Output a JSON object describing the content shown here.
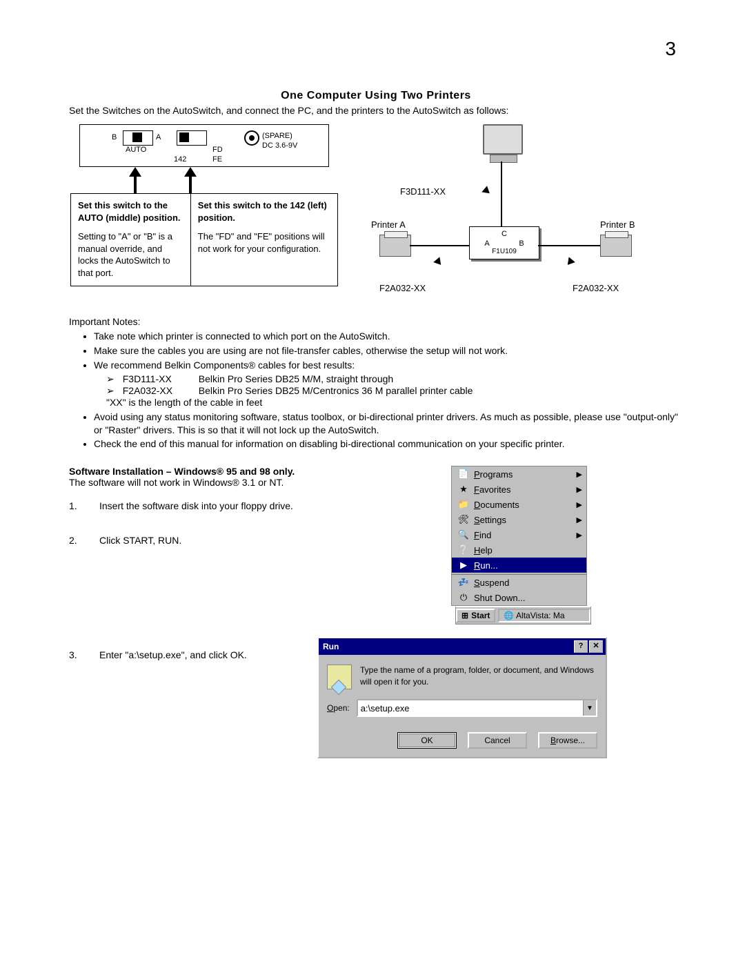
{
  "page_number": "3",
  "title": "One Computer Using Two Printers",
  "intro": "Set the Switches on the AutoSwitch, and connect the PC, and the printers to the AutoSwitch as follows:",
  "switch_panel": {
    "labels": {
      "b": "B",
      "a": "A",
      "auto": "AUTO",
      "n142": "142",
      "fd": "FD",
      "fe": "FE",
      "spare": "(SPARE)",
      "dc": "DC 3.6-9V"
    }
  },
  "note_left": {
    "p1a": "Set this switch to the ",
    "p1b": "AUTO (middle) position.",
    "p2": "Setting to \"A\" or \"B\" is a manual override, and locks the AutoSwitch to that port."
  },
  "note_right": {
    "p1a": "Set this switch to the ",
    "p1b": "142 (left) position.",
    "p2": "The \"FD\" and \"FE\" positions will not work for your configuration."
  },
  "conn": {
    "top_cable": "F3D111-XX",
    "printer_a": "Printer A",
    "printer_b": "Printer B",
    "hub_c": "C",
    "hub_a": "A",
    "hub_b": "B",
    "hub_model": "F1U109",
    "bottom_left": "F2A032-XX",
    "bottom_right": "F2A032-XX"
  },
  "notes_heading": "Important Notes:",
  "bullets": [
    "Take note which printer is connected to which port on the AutoSwitch.",
    "Make sure the cables you are using are not file-transfer cables, otherwise the setup will not work.",
    "We recommend Belkin Components® cables for best results:"
  ],
  "cable_recs": [
    {
      "part": "F3D111-XX",
      "desc": "Belkin Pro Series DB25 M/M, straight through"
    },
    {
      "part": "F2A032-XX",
      "desc": "Belkin Pro Series DB25 M/Centronics 36 M parallel printer cable"
    }
  ],
  "cable_footer": "\"XX\" is the length of the cable in feet",
  "bullets2": [
    "Avoid using any status monitoring software, status toolbox, or bi-directional printer drivers.  As much as possible, please use \"output-only\" or \"Raster\" drivers.  This is so that it will not lock up the AutoSwitch.",
    "Check the end of this manual for information on disabling bi-directional communication on your specific printer."
  ],
  "software_heading": "Software Installation – Windows® 95 and 98 only.",
  "software_sub": "The software will not work in Windows® 3.1 or NT.",
  "steps": {
    "s1": {
      "n": "1.",
      "t": "Insert the software disk into your floppy drive."
    },
    "s2": {
      "n": "2.",
      "t": "Click START, RUN."
    },
    "s3": {
      "n": "3.",
      "t": "Enter \"a:\\setup.exe\", and click OK."
    }
  },
  "start_menu": {
    "items": [
      {
        "icon": "📄",
        "label": "Programs",
        "arrow": true
      },
      {
        "icon": "★",
        "label": "Favorites",
        "arrow": true
      },
      {
        "icon": "📁",
        "label": "Documents",
        "arrow": true
      },
      {
        "icon": "🛠",
        "label": "Settings",
        "arrow": true
      },
      {
        "icon": "🔍",
        "label": "Find",
        "arrow": true
      },
      {
        "icon": "❔",
        "label": "Help",
        "arrow": false
      },
      {
        "icon": "▶",
        "label": "Run...",
        "arrow": false,
        "selected": true
      }
    ],
    "items2": [
      {
        "icon": "💤",
        "label": "Suspend"
      },
      {
        "icon": "⏻",
        "label": "Shut Down..."
      }
    ],
    "start_btn": "Start",
    "task": "AltaVista: Ma"
  },
  "run_dialog": {
    "title": "Run",
    "message": "Type the name of a program, folder, or document, and Windows will open it for you.",
    "open_label": "Open:",
    "input_value": "a:\\setup.exe",
    "ok": "OK",
    "cancel": "Cancel",
    "browse": "Browse..."
  }
}
